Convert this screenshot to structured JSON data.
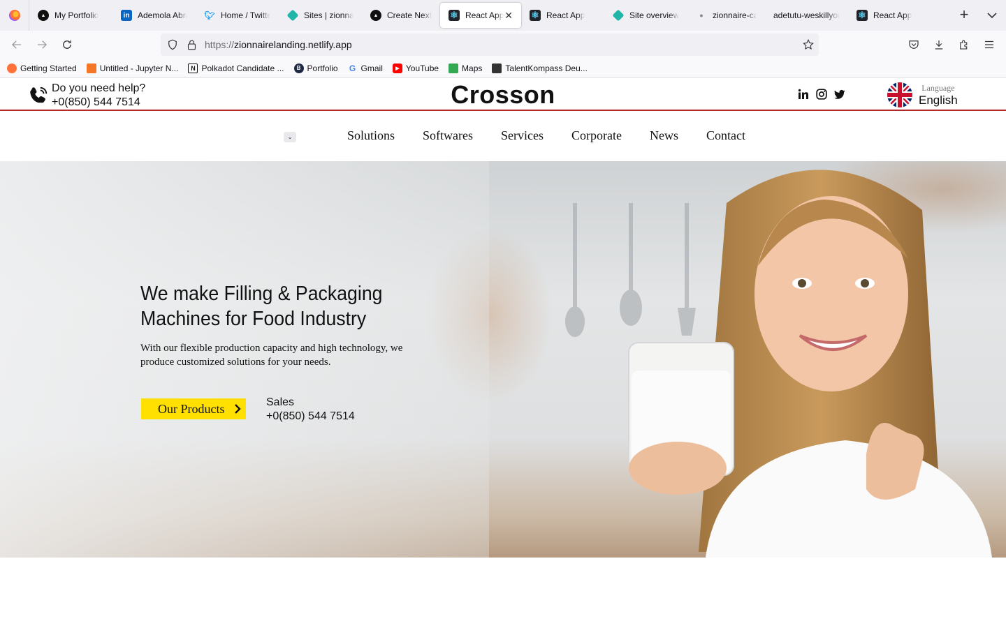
{
  "browser": {
    "tabs": [
      {
        "label": "My Portfolio",
        "icon": "nextjs-icon",
        "color": "#111111"
      },
      {
        "label": "Ademola Abral",
        "icon": "linkedin-icon",
        "color": "#0a66c2"
      },
      {
        "label": "Home / Twitter",
        "icon": "twitter-icon",
        "color": "#1d9bf0"
      },
      {
        "label": "Sites | zionnair",
        "icon": "netlify-icon",
        "color": "#20b5a8"
      },
      {
        "label": "Create Next Ap",
        "icon": "nextjs-icon",
        "color": "#111111"
      },
      {
        "label": "React App",
        "icon": "react-icon",
        "color": "#20232a",
        "active": true
      },
      {
        "label": "React App",
        "icon": "react-icon",
        "color": "#20232a"
      },
      {
        "label": "Site overview |",
        "icon": "netlify-icon",
        "color": "#20b5a8"
      },
      {
        "label": "zionnaire-calc",
        "icon": "dot-icon",
        "color": "#888888"
      },
      {
        "label": "adetutu-weskillyou",
        "icon": "none",
        "color": "#ffffff"
      },
      {
        "label": "React App",
        "icon": "react-icon",
        "color": "#20232a"
      }
    ],
    "url_scheme": "https://",
    "url_host": "zionnairelanding.netlify.app",
    "bookmarks": [
      {
        "label": "Getting Started",
        "icon": "firefox-icon",
        "color": "#ff7139"
      },
      {
        "label": "Untitled - Jupyter N...",
        "icon": "jupyter-icon",
        "color": "#f37726"
      },
      {
        "label": "Polkadot Candidate ...",
        "icon": "notion-icon",
        "color": "#111111"
      },
      {
        "label": "Portfolio",
        "icon": "portfolio-icon",
        "color": "#1e2a44"
      },
      {
        "label": "Gmail",
        "icon": "google-icon",
        "color": "#4285f4"
      },
      {
        "label": "YouTube",
        "icon": "youtube-icon",
        "color": "#ff0000"
      },
      {
        "label": "Maps",
        "icon": "maps-icon",
        "color": "#34a853"
      },
      {
        "label": "TalentKompass Deu...",
        "icon": "talentkompass-icon",
        "color": "#333333"
      }
    ]
  },
  "site": {
    "help_line1": "Do you need help?",
    "help_line2": "+0(850) 544 7514",
    "brand": "Crosson",
    "social": [
      "linkedin-icon",
      "instagram-icon",
      "twitter-icon"
    ],
    "language_label": "Language",
    "language_value": "English",
    "menu": [
      "Solutions",
      "Softwares",
      "Services",
      "Corporate",
      "News",
      "Contact"
    ],
    "accent_red": "#b02a2a",
    "hero": {
      "title": "We make Filling & Packaging Machines for Food Industry",
      "subtitle": "With our flexible production capacity and high technology, we produce customized solutions for your needs.",
      "cta": "Our Products",
      "cta_color": "#ffe000",
      "sales_label": "Sales",
      "sales_phone": "+0(850) 544 7514"
    }
  }
}
